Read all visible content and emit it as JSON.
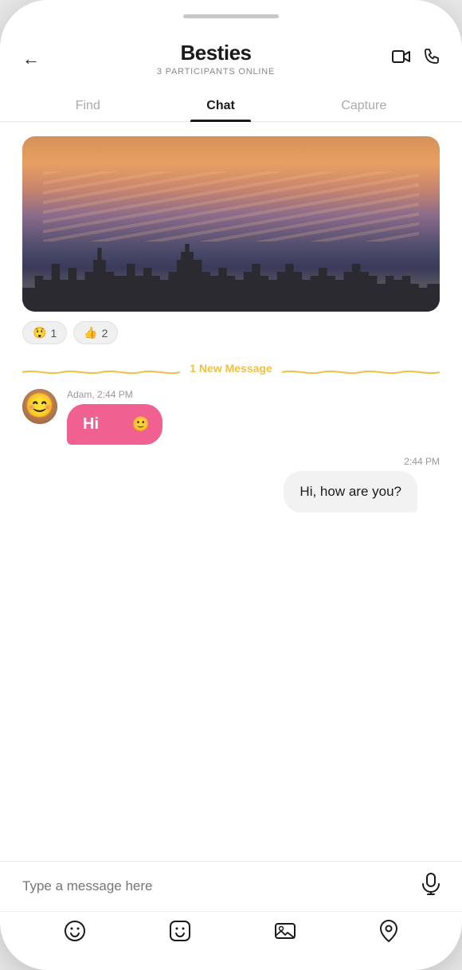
{
  "phone": {
    "header": {
      "back_label": "←",
      "title": "Besties",
      "subtitle": "3 PARTICIPANTS ONLINE",
      "video_icon": "□◄",
      "phone_icon": "☏"
    },
    "tabs": [
      {
        "label": "Find",
        "active": false
      },
      {
        "label": "Chat",
        "active": true
      },
      {
        "label": "Capture",
        "active": false
      }
    ],
    "reactions": [
      {
        "emoji": "😲",
        "count": "1"
      },
      {
        "emoji": "👍",
        "count": "2"
      }
    ],
    "new_message_divider": "1 New Message",
    "messages": [
      {
        "type": "incoming",
        "sender": "Adam",
        "time": "2:44 PM",
        "text": "Hi",
        "emoji_btn": "🙂"
      },
      {
        "type": "outgoing",
        "time": "2:44 PM",
        "text": "Hi, how are you?"
      }
    ],
    "input": {
      "placeholder": "Type a message here"
    },
    "toolbar_icons": [
      {
        "name": "emoji-icon",
        "symbol": "☺"
      },
      {
        "name": "sticker-icon",
        "symbol": "🤖"
      },
      {
        "name": "image-icon",
        "symbol": "🖼"
      },
      {
        "name": "location-icon",
        "symbol": "📍"
      }
    ]
  }
}
